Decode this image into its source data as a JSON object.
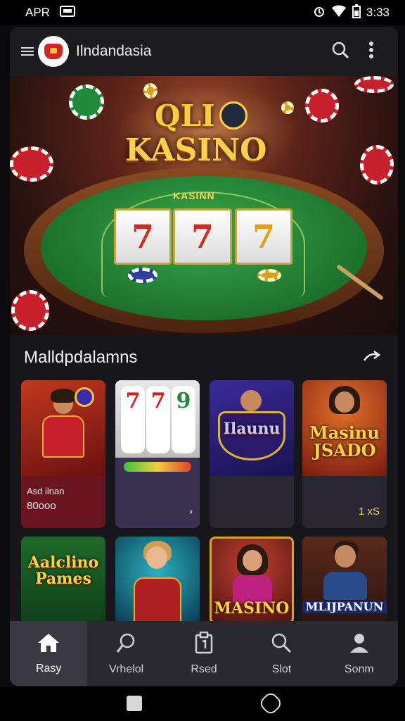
{
  "status_bar": {
    "left_label": "APR",
    "time": "3:33",
    "icons": [
      "card-icon",
      "alarm-icon",
      "wifi-icon",
      "battery-icon"
    ]
  },
  "app_bar": {
    "title": "Ilndandasia",
    "icons": [
      "menu-icon",
      "app-logo",
      "search-icon",
      "more-vert-icon"
    ]
  },
  "hero": {
    "title_line1": "QLI",
    "title_line2": "KASINO",
    "table_label": "KASINN",
    "reels": [
      "7",
      "7",
      "7"
    ]
  },
  "section": {
    "title": "Malldpdalamns",
    "action_icon": "arrow-icon"
  },
  "games": [
    {
      "art_text": "",
      "sub_title": "Asd ilnan",
      "sub_value": "80ooo",
      "meta": ""
    },
    {
      "art_text": "",
      "sub_title": "",
      "sub_value": "",
      "meta": "›"
    },
    {
      "art_text": "Ilaunu",
      "sub_title": "",
      "sub_value": "",
      "meta": ""
    },
    {
      "art_text": "Masinu JSADO",
      "sub_title": "",
      "sub_value": "",
      "meta": "1 xS"
    },
    {
      "art_text": "Aalclino Pames",
      "sub_title": "",
      "sub_value": "",
      "meta": ""
    },
    {
      "art_text": "",
      "sub_title": "",
      "sub_value": "",
      "meta": ""
    },
    {
      "art_text": "MASINO",
      "sub_title": "",
      "sub_value": "",
      "meta": ""
    },
    {
      "art_text": "MLIJPANUN",
      "sub_title": "",
      "sub_value": "",
      "meta": ""
    }
  ],
  "bottom_nav": [
    {
      "label": "Rasy",
      "icon": "home-icon",
      "active": true
    },
    {
      "label": "Vrhelol",
      "icon": "search-icon",
      "active": false
    },
    {
      "label": "Rsed",
      "icon": "card-icon",
      "active": false
    },
    {
      "label": "Slot",
      "icon": "search-icon",
      "active": false
    },
    {
      "label": "Sonm",
      "icon": "profile-icon",
      "active": false
    }
  ],
  "colors": {
    "background": "#17161b",
    "accent_gold": "#ffd04a",
    "felt_green": "#1f7a30",
    "nav_bg": "#2a2830"
  }
}
